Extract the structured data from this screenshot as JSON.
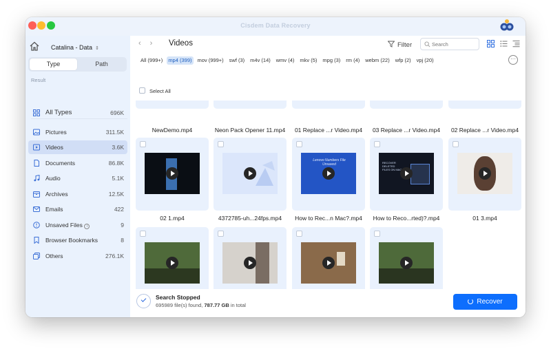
{
  "app": {
    "title": "Cisdem Data Recovery"
  },
  "sidebar": {
    "drive": "Catalina - Data",
    "tabs": [
      {
        "label": "Type",
        "active": true
      },
      {
        "label": "Path",
        "active": false
      }
    ],
    "result_label": "Result",
    "all_types": {
      "label": "All Types",
      "count": "696K"
    },
    "items": [
      {
        "label": "Pictures",
        "count": "311.5K",
        "icon": "pictures-icon"
      },
      {
        "label": "Videos",
        "count": "3.6K",
        "icon": "videos-icon",
        "selected": true
      },
      {
        "label": "Documents",
        "count": "86.8K",
        "icon": "documents-icon"
      },
      {
        "label": "Audio",
        "count": "5.1K",
        "icon": "audio-icon"
      },
      {
        "label": "Archives",
        "count": "12.5K",
        "icon": "archives-icon"
      },
      {
        "label": "Emails",
        "count": "422",
        "icon": "emails-icon"
      },
      {
        "label": "Unsaved Files",
        "count": "9",
        "icon": "unsaved-files-icon"
      },
      {
        "label": "Browser Bookmarks",
        "count": "8",
        "icon": "bookmarks-icon"
      },
      {
        "label": "Others",
        "count": "276.1K",
        "icon": "others-icon"
      }
    ]
  },
  "header": {
    "title": "Videos",
    "filter_label": "Filter",
    "search_placeholder": "Search"
  },
  "file_tabs": [
    "All (999+)",
    "mp4 (399)",
    "mov (999+)",
    "swf (3)",
    "m4v (14)",
    "wmv (4)",
    "mkv (5)",
    "mpg (3)",
    "rm (4)",
    "webm (22)",
    "wfp (2)",
    "vpj (20)"
  ],
  "select_all_label": "Select All",
  "rows": [
    [
      {
        "name": "NewDemo.mp4"
      },
      {
        "name": "Neon Pack Opener 11.mp4"
      },
      {
        "name": "01 Replace ...r Video.mp4"
      },
      {
        "name": "03 Replace ...r Video.mp4"
      },
      {
        "name": "02 Replace ...r Video.mp4"
      }
    ],
    [
      {
        "name": "02 1.mp4",
        "thumb_bg": "#0a0e14",
        "thumb_accent": "#3b6fb0"
      },
      {
        "name": "4372785-uh...24fps.mp4",
        "thumb_bg": "#dbe6fb",
        "thumb_accent": "#b9ccf2"
      },
      {
        "name": "How to Rec...n Mac?.mp4",
        "thumb_bg": "#2355c5",
        "thumb_accent": "#e8eefc",
        "thumb_text": "Lenovo Numbers File Unsaved"
      },
      {
        "name": "How to Reco...rted)?.mp4",
        "thumb_bg": "#111622",
        "thumb_accent": "#5a86d6",
        "thumb_text": "RECOVER DELETED FILES ON MAC"
      },
      {
        "name": "01 3.mp4",
        "thumb_bg": "#efece8",
        "thumb_accent": "#5a4033"
      }
    ],
    [
      {
        "name": "",
        "thumb_bg": "#4f6a3a",
        "thumb_accent": "#2c3820"
      },
      {
        "name": "",
        "thumb_bg": "#d6d2cc",
        "thumb_accent": "#7a6d63"
      },
      {
        "name": "",
        "thumb_bg": "#8a6a4a",
        "thumb_accent": "#e3d9c6"
      },
      {
        "name": "",
        "thumb_bg": "#4e6a3a",
        "thumb_accent": "#2a3520"
      }
    ]
  ],
  "footer": {
    "status_title": "Search Stopped",
    "found_count": "695989",
    "found_text": "file(s) found,",
    "total_size": "787.77 GB",
    "total_text": "in total",
    "recover_label": "Recover"
  },
  "colors": {
    "accent": "#0d6efd",
    "sidebar_bg": "#eaf2fd",
    "card_bg": "#e9f1fd"
  }
}
